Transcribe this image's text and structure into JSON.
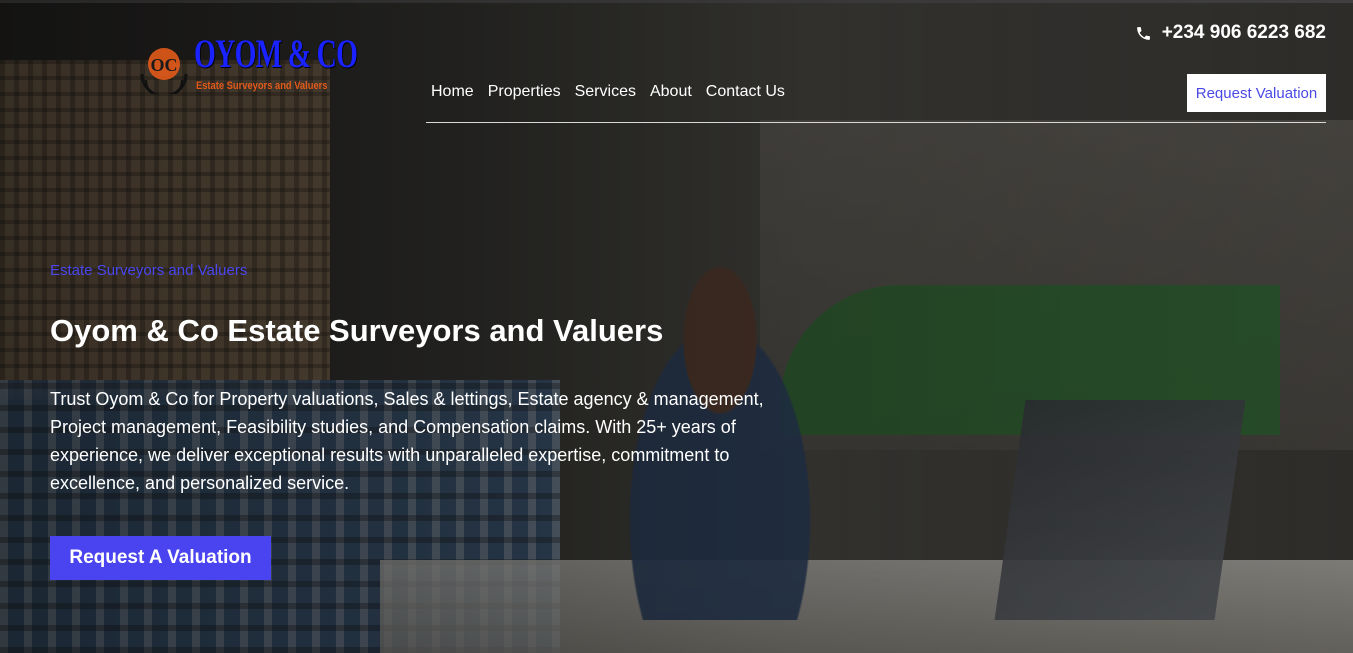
{
  "brand": {
    "logo_text": "OYOM & CO",
    "logo_subtitle": "Estate Surveyors and Valuers",
    "logo_mark_text": "OC"
  },
  "header": {
    "phone": "+234 906 6223 682",
    "nav": [
      {
        "label": "Home"
      },
      {
        "label": "Properties"
      },
      {
        "label": "Services"
      },
      {
        "label": "About"
      },
      {
        "label": "Contact Us"
      }
    ],
    "request_button": "Request Valuation"
  },
  "hero": {
    "eyebrow": "Estate Surveyors and Valuers",
    "title": "Oyom & Co Estate Surveyors and Valuers",
    "description": "Trust Oyom & Co for Property valuations, Sales & lettings, Estate agency & management, Project management, Feasibility studies, and Compensation claims. With 25+ years of experience, we deliver exceptional results with unparalleled expertise, commitment to excellence, and personalized service.",
    "cta": "Request A Valuation"
  },
  "colors": {
    "accent": "#4a43f0",
    "logo_blue": "#1a23ff",
    "logo_orange": "#e25a1a",
    "text": "#ffffff"
  },
  "icons": {
    "phone": "phone-icon",
    "logo_mark": "logo-mark-icon"
  }
}
